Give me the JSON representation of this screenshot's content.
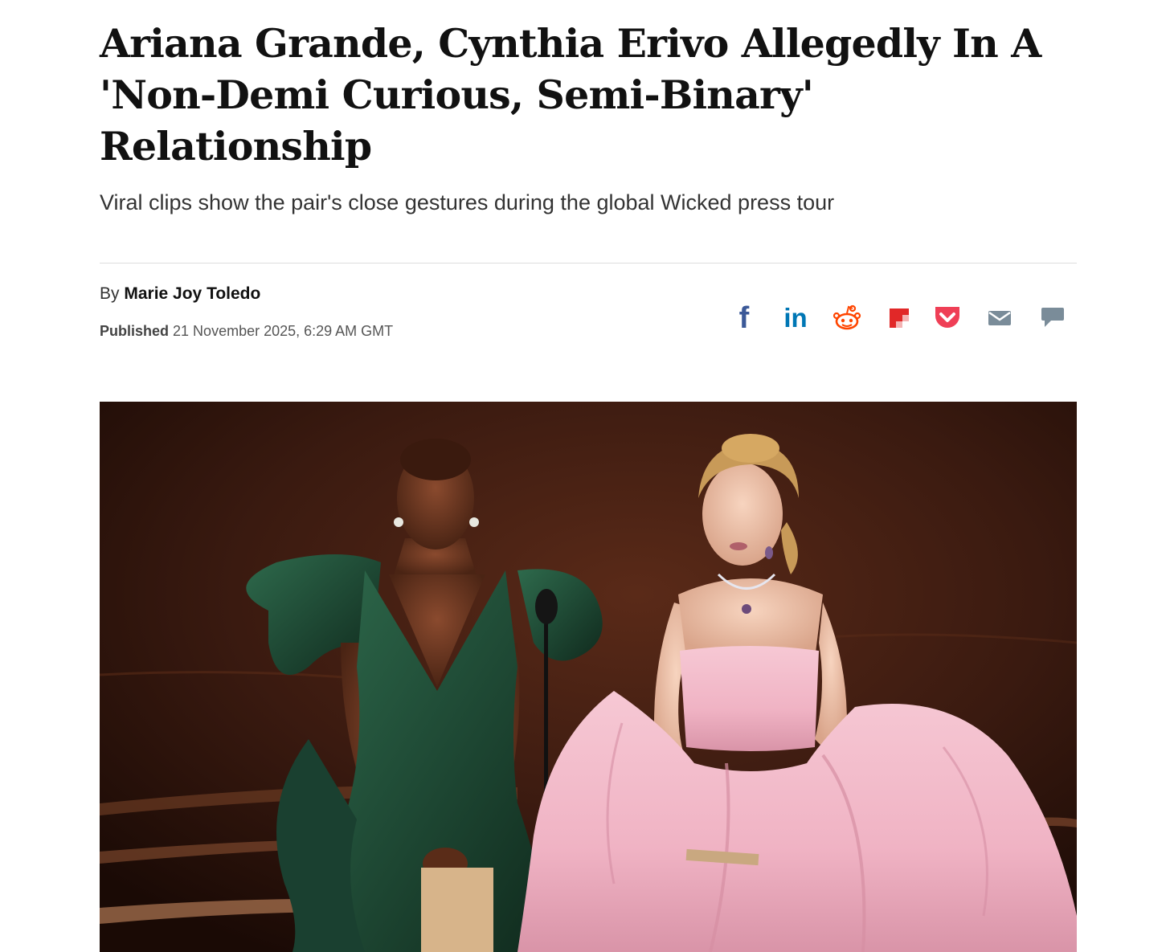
{
  "article": {
    "headline": "Ariana Grande, Cynthia Erivo Allegedly In A 'Non-Demi Curious, Semi-Binary' Relationship",
    "subheadline": "Viral clips show the pair's close gestures during the global Wicked press tour",
    "byline_prefix": "By",
    "author": "Marie Joy Toledo",
    "published_label": "Published",
    "published_date": "21 November 2025, 6:29 AM GMT"
  },
  "share": {
    "items": [
      {
        "name": "facebook-icon",
        "color": "#3b5998"
      },
      {
        "name": "linkedin-icon",
        "color": "#0077b5"
      },
      {
        "name": "reddit-icon",
        "color": "#ff4500"
      },
      {
        "name": "flipboard-icon",
        "color": "#e12828"
      },
      {
        "name": "pocket-icon",
        "color": "#ef3f56"
      },
      {
        "name": "email-icon",
        "color": "#7a8c99"
      },
      {
        "name": "comment-icon",
        "color": "#7a8c99"
      }
    ],
    "facebook_glyph": "f",
    "linkedin_glyph": "in"
  },
  "hero_image": {
    "description_icon": "photo-two-women-on-stage",
    "colors": {
      "background": "#3a1a10",
      "green_dress": "#1f4a35",
      "pink_dress": "#f2b9c9"
    }
  }
}
